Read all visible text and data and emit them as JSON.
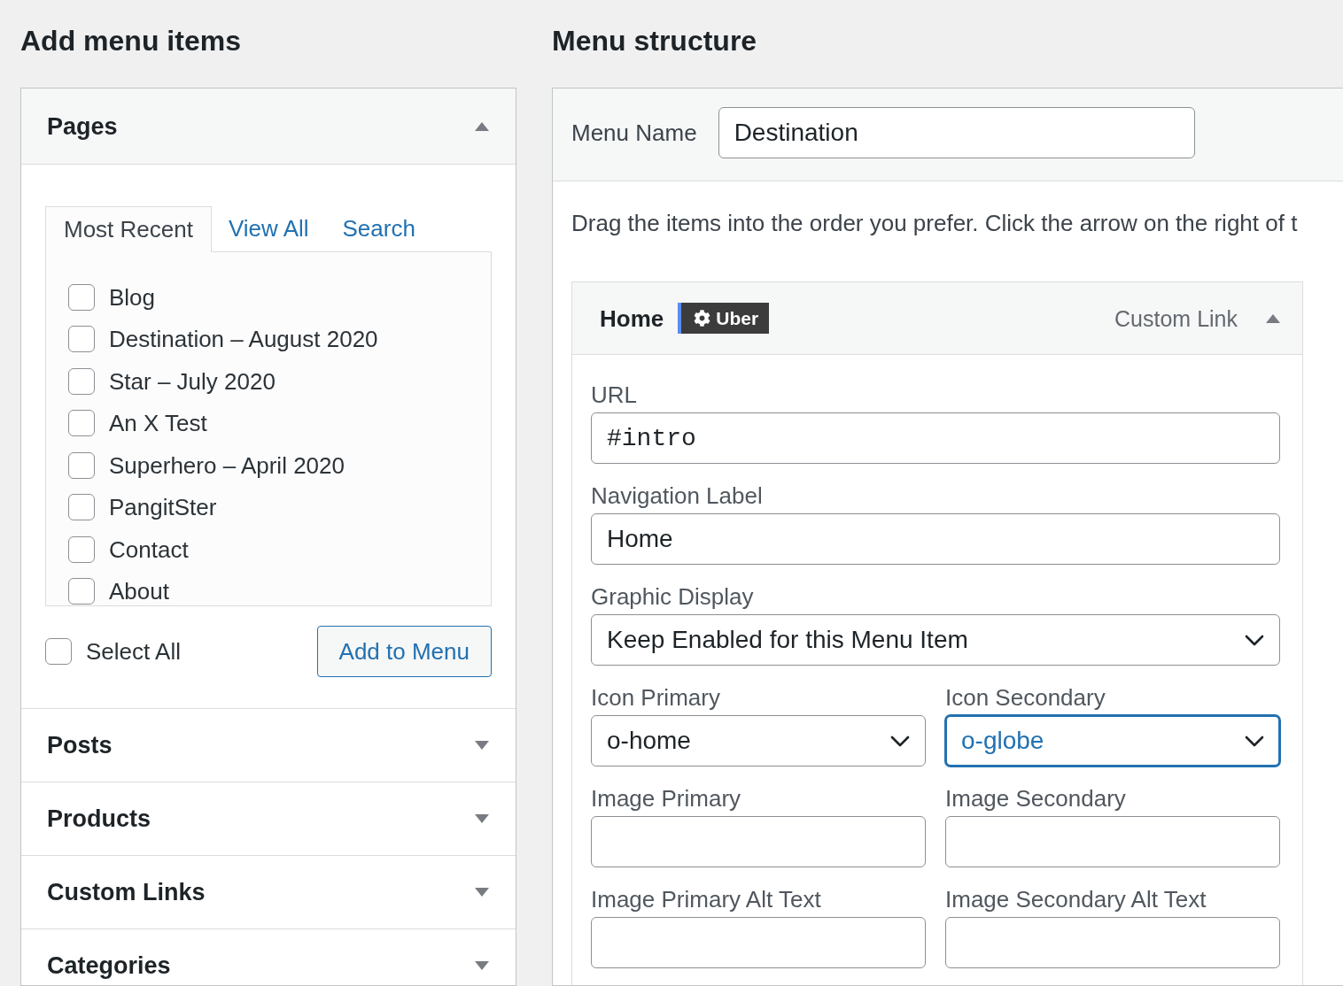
{
  "add_menu_items": {
    "heading": "Add menu items",
    "sections": [
      {
        "title": "Pages",
        "expanded": true,
        "tabs": [
          {
            "label": "Most Recent",
            "selected": true
          },
          {
            "label": "View All",
            "selected": false
          },
          {
            "label": "Search",
            "selected": false
          }
        ],
        "items": [
          {
            "label": "Blog",
            "checked": false
          },
          {
            "label": "Destination – August 2020",
            "checked": false
          },
          {
            "label": "Star – July 2020",
            "checked": false
          },
          {
            "label": "An X Test",
            "checked": false
          },
          {
            "label": "Superhero – April 2020",
            "checked": false
          },
          {
            "label": "PangitSter",
            "checked": false
          },
          {
            "label": "Contact",
            "checked": false
          },
          {
            "label": "About",
            "checked": false
          }
        ],
        "select_all": {
          "label": "Select All",
          "checked": false
        },
        "button": "Add to Menu"
      },
      {
        "title": "Posts",
        "expanded": false
      },
      {
        "title": "Products",
        "expanded": false
      },
      {
        "title": "Custom Links",
        "expanded": false
      },
      {
        "title": "Categories",
        "expanded": false
      }
    ]
  },
  "menu_structure": {
    "heading": "Menu structure",
    "menu_name": {
      "label": "Menu Name",
      "value": "Destination"
    },
    "instructions": "Drag the items into the order you prefer. Click the arrow on the right of t",
    "menu_items": [
      {
        "title": "Home",
        "badge": "Uber",
        "type": "Custom Link",
        "expanded": true,
        "field_rows": [
          [
            {
              "kind": "url",
              "label": "URL",
              "value": "#intro",
              "focused": false
            }
          ],
          [
            {
              "kind": "text",
              "label": "Navigation Label",
              "value": "Home",
              "focused": false
            }
          ],
          [
            {
              "kind": "select",
              "label": "Graphic Display",
              "value": "Keep Enabled for this Menu Item",
              "focused": false
            }
          ],
          [
            {
              "kind": "select",
              "label": "Icon Primary",
              "value": "o-home",
              "focused": false
            },
            {
              "kind": "select",
              "label": "Icon Secondary",
              "value": "o-globe",
              "focused": true
            }
          ],
          [
            {
              "kind": "text",
              "label": "Image Primary",
              "focused": false
            },
            {
              "kind": "text",
              "label": "Image Secondary",
              "focused": false
            }
          ],
          [
            {
              "kind": "text",
              "label": "Image Primary Alt Text",
              "focused": false
            },
            {
              "kind": "text",
              "label": "Image Secondary Alt Text",
              "focused": false
            }
          ]
        ]
      }
    ]
  }
}
